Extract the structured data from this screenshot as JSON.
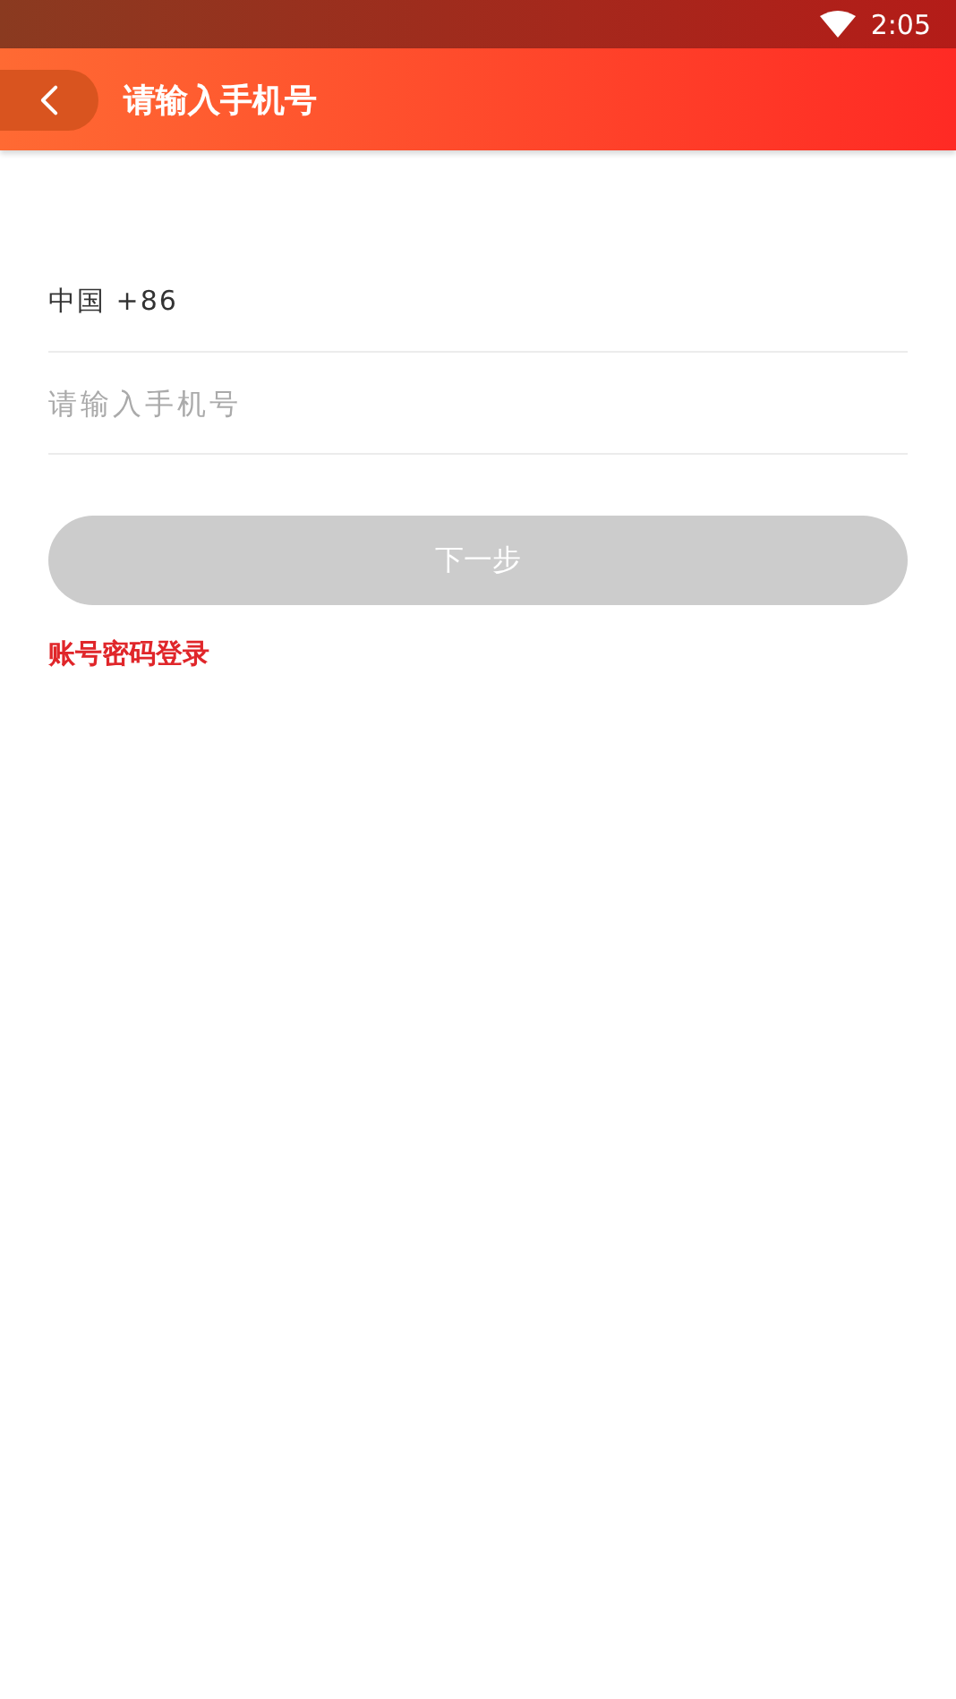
{
  "status_bar": {
    "time": "2:05"
  },
  "header": {
    "title": "请输入手机号"
  },
  "country_code": "中国 +86",
  "phone_field": {
    "placeholder": "请输入手机号"
  },
  "next_button": {
    "label": "下一步",
    "disabled": true
  },
  "alt_login_link": "账号密码登录"
}
